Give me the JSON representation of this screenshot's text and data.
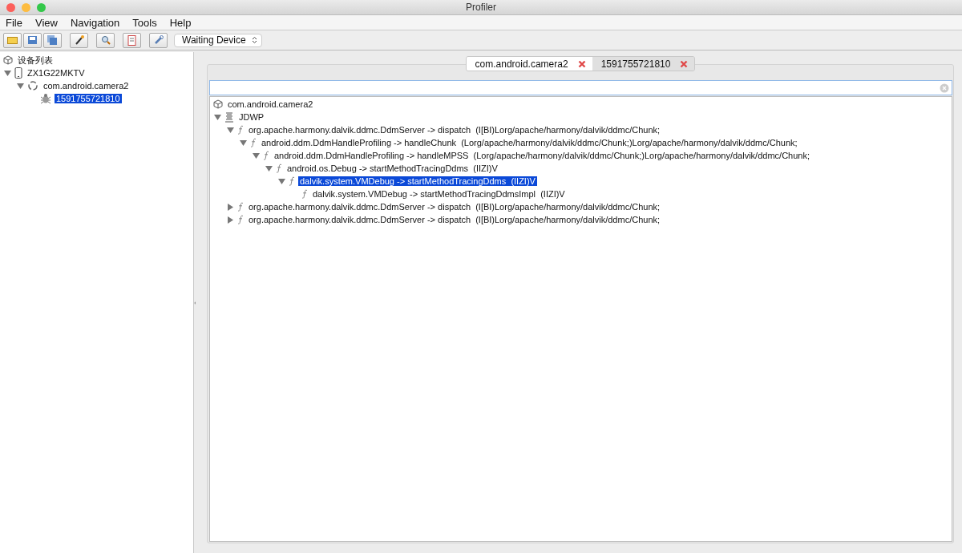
{
  "window": {
    "title": "Profiler"
  },
  "menu": [
    "File",
    "View",
    "Navigation",
    "Tools",
    "Help"
  ],
  "toolbar": {
    "device_select": "Waiting Device"
  },
  "device_tree": {
    "label": "设备列表",
    "kind": "root",
    "selected": false,
    "children": [
      {
        "label": "ZX1G22MKTV",
        "kind": "device",
        "expanded": true,
        "selected": false,
        "children": [
          {
            "label": "com.android.camera2",
            "kind": "app",
            "expanded": true,
            "selected": false,
            "children": [
              {
                "label": "1591755721810",
                "kind": "trace",
                "selected": true
              }
            ]
          }
        ]
      }
    ]
  },
  "tabs": [
    {
      "label": "com.android.camera2",
      "selected": true
    },
    {
      "label": "1591755721810",
      "selected": false
    }
  ],
  "call_tree": {
    "label": "com.android.camera2",
    "kind": "root",
    "selected": false,
    "children": [
      {
        "label": "JDWP",
        "kind": "thread",
        "expanded": true,
        "selected": false,
        "children": [
          {
            "label": "org.apache.harmony.dalvik.ddmc.DdmServer -> dispatch  (I[BI)Lorg/apache/harmony/dalvik/ddmc/Chunk;",
            "kind": "method",
            "expanded": true,
            "selected": false,
            "children": [
              {
                "label": "android.ddm.DdmHandleProfiling -> handleChunk  (Lorg/apache/harmony/dalvik/ddmc/Chunk;)Lorg/apache/harmony/dalvik/ddmc/Chunk;",
                "kind": "method",
                "expanded": true,
                "selected": false,
                "children": [
                  {
                    "label": "android.ddm.DdmHandleProfiling -> handleMPSS  (Lorg/apache/harmony/dalvik/ddmc/Chunk;)Lorg/apache/harmony/dalvik/ddmc/Chunk;",
                    "kind": "method",
                    "expanded": true,
                    "selected": false,
                    "children": [
                      {
                        "label": "android.os.Debug -> startMethodTracingDdms  (IIZI)V",
                        "kind": "method",
                        "expanded": true,
                        "selected": false,
                        "children": [
                          {
                            "label": "dalvik.system.VMDebug -> startMethodTracingDdms  (IIZI)V",
                            "kind": "method",
                            "expanded": true,
                            "selected": true,
                            "children": [
                              {
                                "label": "dalvik.system.VMDebug -> startMethodTracingDdmsImpl  (IIZI)V",
                                "kind": "method",
                                "selected": false
                              }
                            ]
                          }
                        ]
                      }
                    ]
                  }
                ]
              }
            ]
          },
          {
            "label": "org.apache.harmony.dalvik.ddmc.DdmServer -> dispatch  (I[BI)Lorg/apache/harmony/dalvik/ddmc/Chunk;",
            "kind": "method",
            "expanded": false,
            "selected": false
          },
          {
            "label": "org.apache.harmony.dalvik.ddmc.DdmServer -> dispatch  (I[BI)Lorg/apache/harmony/dalvik/ddmc/Chunk;",
            "kind": "method",
            "expanded": false,
            "selected": false
          }
        ]
      }
    ]
  }
}
